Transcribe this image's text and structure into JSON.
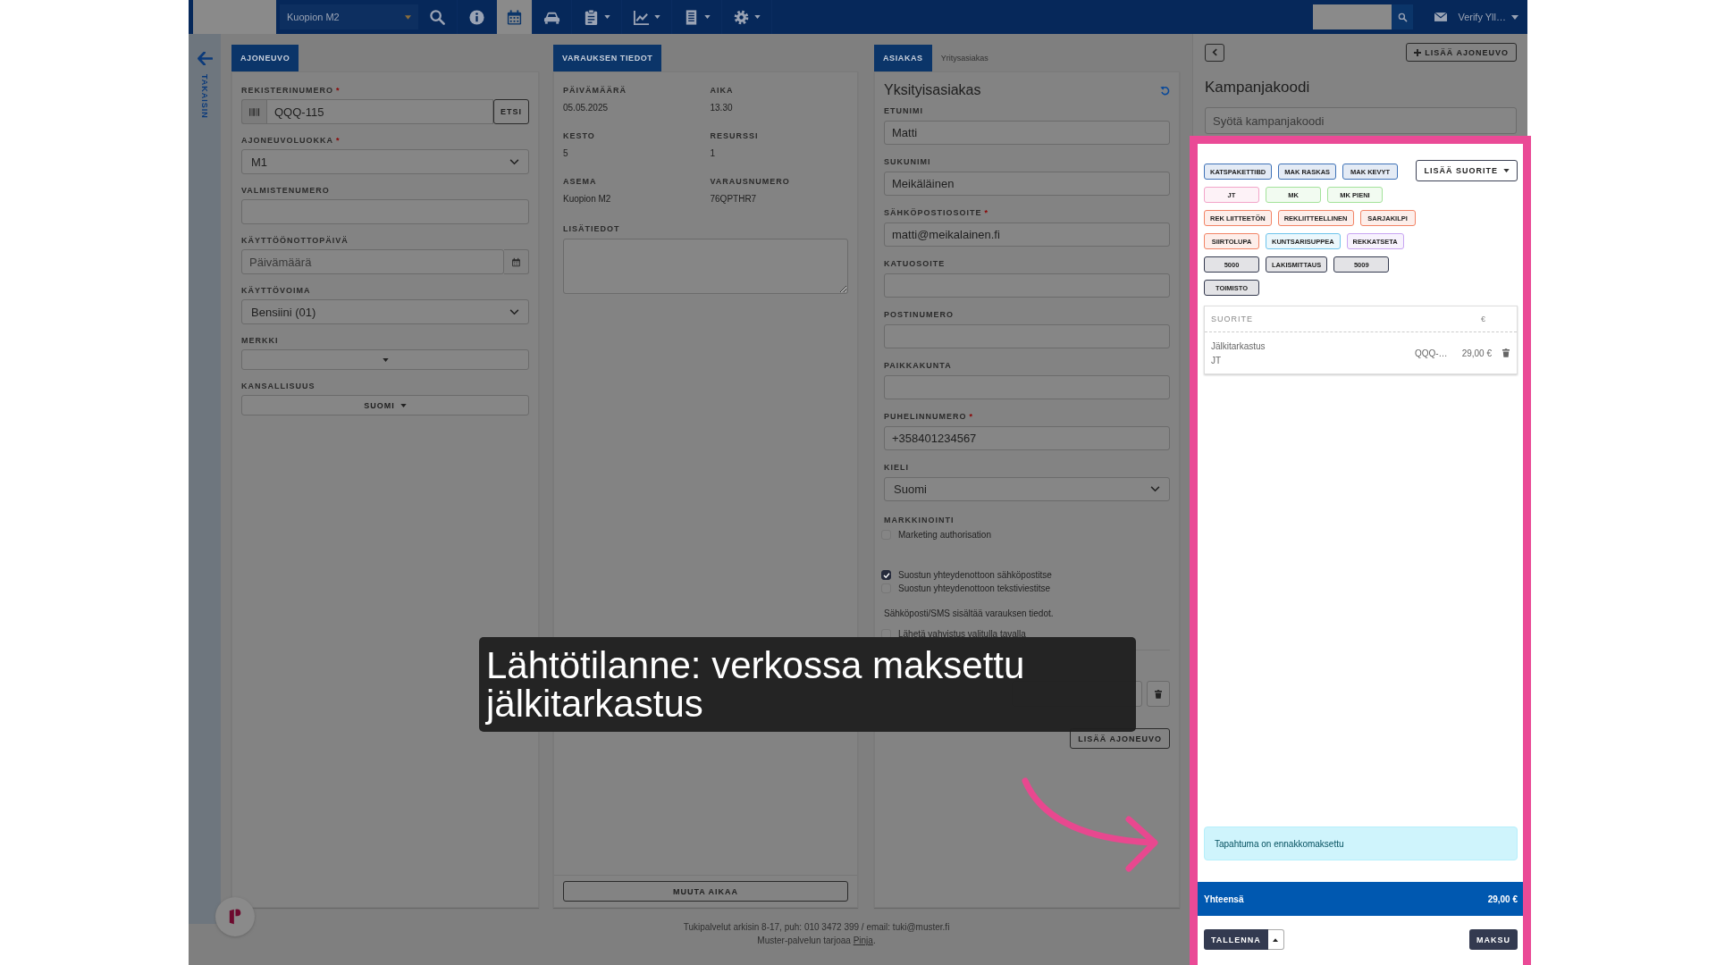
{
  "topbar": {
    "location": "Kuopion M2",
    "nav": [
      {
        "kind": "search",
        "selected": false,
        "dropdown": false
      },
      {
        "kind": "info",
        "selected": false,
        "dropdown": false
      },
      {
        "kind": "calendar",
        "selected": true,
        "dropdown": false
      },
      {
        "kind": "car",
        "selected": false,
        "dropdown": false
      },
      {
        "kind": "clipboard",
        "selected": false,
        "dropdown": true
      },
      {
        "kind": "chart",
        "selected": false,
        "dropdown": true
      },
      {
        "kind": "document",
        "selected": false,
        "dropdown": true
      },
      {
        "kind": "gear",
        "selected": false,
        "dropdown": true
      }
    ],
    "user": "Verify Yll…"
  },
  "back_rail": {
    "label": "TAKAISIN"
  },
  "vehicle": {
    "tab": "AJONEUVO",
    "fields": [
      {
        "label": "REKISTERINUMERO",
        "required_mark": "*",
        "kind": "plate",
        "value": "QQQ-115",
        "button": "ETSI"
      },
      {
        "label": "AJONEUVOLUOKKA",
        "required_mark": "*",
        "kind": "select",
        "value": "M1"
      },
      {
        "label": "VALMISTENUMERO",
        "kind": "text"
      },
      {
        "label": "KÄYTTÖÖNOTTOPÄIVÄ",
        "kind": "date",
        "placeholder": "Päivämäärä"
      },
      {
        "label": "KÄYTTÖVOIMA",
        "kind": "select",
        "value": "Bensiini (01)"
      },
      {
        "label": "MERKKI",
        "kind": "dropdown"
      },
      {
        "label": "KANSALLISUUS",
        "kind": "dropdown",
        "value": "SUOMI"
      }
    ]
  },
  "booking": {
    "tab": "VARAUKSEN TIEDOT",
    "details": [
      {
        "label": "PÄIVÄMÄÄRÄ",
        "value": "05.05.2025"
      },
      {
        "label": "AIKA",
        "value": "13.30"
      },
      {
        "label": "KESTO",
        "value": "5"
      },
      {
        "label": "RESURSSI",
        "value": "1"
      },
      {
        "label": "ASEMA",
        "value": "Kuopion M2"
      },
      {
        "label": "VARAUSNUMERO",
        "value": "76QPTHR7"
      }
    ],
    "notes_label": "LISÄTIEDOT",
    "button": "MUUTA AIKAA"
  },
  "customer": {
    "tabs": [
      {
        "label": "ASIAKAS",
        "selected": true
      },
      {
        "label": "Yritysasiakas",
        "selected": false
      }
    ],
    "title": "Yksityisasiakas",
    "fields": [
      {
        "label": "ETUNIMI",
        "kind": "text",
        "value": "Matti"
      },
      {
        "label": "SUKUNIMI",
        "kind": "text",
        "value": "Meikäläinen"
      },
      {
        "label": "SÄHKÖPOSTIOSOITE",
        "required_mark": "*",
        "kind": "text",
        "value": "matti@meikalainen.fi"
      },
      {
        "label": "KATUOSOITE",
        "kind": "text"
      },
      {
        "label": "POSTINUMERO",
        "kind": "text"
      },
      {
        "label": "PAIKKAKUNTA",
        "kind": "text"
      },
      {
        "label": "PUHELINNUMERO",
        "required_mark": "*",
        "kind": "text",
        "value": "+358401234567"
      },
      {
        "label": "KIELI",
        "kind": "select",
        "value": "Suomi"
      }
    ],
    "marketing": {
      "label": "MARKKINOINTI",
      "options": [
        {
          "label": "Marketing authorisation",
          "checked": false
        }
      ]
    },
    "consents": [
      {
        "label": "Suostun yhteydenottoon sähköpostitse",
        "checked": true
      },
      {
        "label": "Suostun yhteydenottoon tekstiviestitse",
        "checked": false
      }
    ],
    "note": "Sähköposti/SMS sisältää varauksen tiedot.",
    "confirm": {
      "label": "Lähetä vahvistus valitulla tavalla",
      "checked": false
    },
    "add_vehicle": "LISÄÄ AJONEUVO"
  },
  "side": {
    "add_vehicle": "LISÄÄ AJONEUVO",
    "campaign_title": "Kampanjakoodi",
    "campaign_placeholder": "Syötä kampanjakoodi",
    "chip_rows": [
      {
        "chips": [
          {
            "label": "KATSPAKETTIBD",
            "color": "#3f72b8"
          },
          {
            "label": "MAK RASKAS",
            "color": "#3f72b8"
          },
          {
            "label": "MAK KEVYT",
            "color": "#3f72b8"
          }
        ]
      },
      {
        "chips": [
          {
            "label": "JT",
            "color": "#f2a5c9"
          },
          {
            "label": "MK",
            "color": "#a3e29a"
          },
          {
            "label": "MK PIENI",
            "color": "#a3e29a"
          }
        ]
      },
      {
        "chips": [
          {
            "label": "REK LIITTEETÖN",
            "color": "#f28466"
          },
          {
            "label": "REKLIITTEELLINEN",
            "color": "#f28466"
          },
          {
            "label": "SARJAKILPI",
            "color": "#f28466"
          }
        ]
      },
      {
        "chips": [
          {
            "label": "SIIRTOLUPA",
            "color": "#f28466"
          },
          {
            "label": "KUNTSARISUPPEA",
            "color": "#6ec4ec"
          },
          {
            "label": "REKKATSETA",
            "color": "#c8a5f2"
          }
        ]
      },
      {
        "chips": [
          {
            "label": "5000",
            "color": "#343a4f"
          },
          {
            "label": "LAKISMITTAUS",
            "color": "#343a4f"
          },
          {
            "label": "5009",
            "color": "#343a4f"
          }
        ]
      },
      {
        "chips": [
          {
            "label": "TOIMISTO",
            "color": "#343a4f"
          }
        ]
      }
    ],
    "add_service": "LISÄÄ SUORITE",
    "table": {
      "columns": [
        "SUORITE",
        "€"
      ],
      "rows": [
        {
          "name": "Jälkitarkastus",
          "code": "JT",
          "vehicle": "QQQ-…",
          "price": "29,00 €"
        }
      ]
    },
    "alert": "Tapahtuma on ennakkomaksettu",
    "total_label": "Yhteensä",
    "total": "29,00 €",
    "save": "TALLENNA",
    "pay": "MAKSU"
  },
  "footer": {
    "support": "Tukipalvelut arkisin 8-17, puh: 010 3472 399 / email: tuki@muster.fi",
    "credit": "Muster-palvelun tarjoaa",
    "link": "Pinja",
    "end": "."
  },
  "caption": {
    "text": "Lähtötilanne: verkossa maksettu jälkitarkastus"
  }
}
